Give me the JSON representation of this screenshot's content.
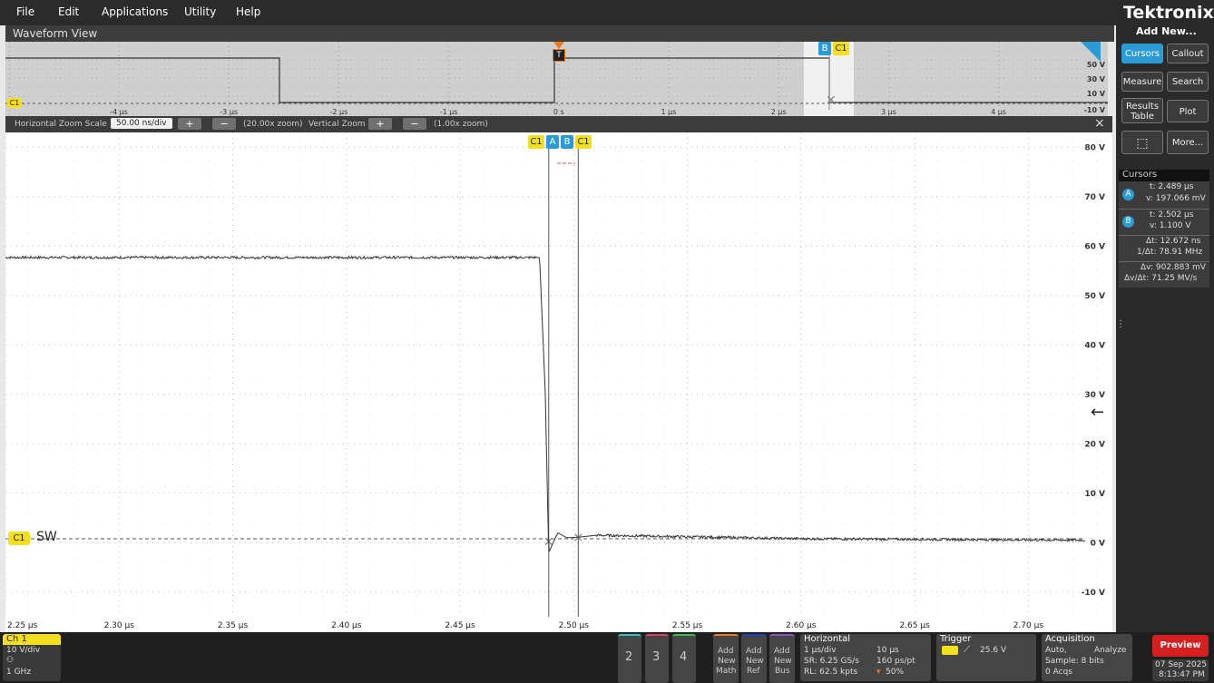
{
  "menu": {
    "items": [
      "File",
      "Edit",
      "Applications",
      "Utility",
      "Help"
    ]
  },
  "waveform_view": {
    "title": "Waveform View"
  },
  "overview": {
    "x_ticks": [
      "-4 µs",
      "-3 µs",
      "-2 µs",
      "-1 µs",
      "0 s",
      "1 µs",
      "2 µs",
      "3 µs",
      "4 µs"
    ],
    "y_ticks": [
      "50 V",
      "30 V",
      "10 V",
      "-10 V"
    ],
    "trigger_marker": "T",
    "cursor_b_label": "B",
    "channel_label": "C1"
  },
  "zoom_bar": {
    "h_label": "Horizontal Zoom Scale",
    "h_value": "50.00 ns/div",
    "h_zoom": "(20.00x zoom)",
    "v_label": "Vertical Zoom",
    "v_zoom": "(1.00x zoom)",
    "close": "×"
  },
  "main_plot": {
    "y_ticks": [
      "80 V",
      "70 V",
      "60 V",
      "50 V",
      "40 V",
      "30 V",
      "20 V",
      "10 V",
      "0 V",
      "-10 V"
    ],
    "x_ticks": [
      "2.25 µs",
      "2.30 µs",
      "2.35 µs",
      "2.40 µs",
      "2.45 µs",
      "2.50 µs",
      "2.55 µs",
      "2.60 µs",
      "2.65 µs",
      "2.70 µs"
    ],
    "channel_tag": "C1",
    "channel_name": "SW",
    "cursor_tags": [
      "C1",
      "A",
      "B",
      "C1"
    ]
  },
  "chart_data": {
    "type": "line",
    "series": [
      {
        "x": [
          2.25,
          2.485,
          2.4875,
          2.489,
          2.493,
          2.497,
          2.502,
          2.51,
          2.6,
          2.725
        ],
        "y": [
          57.7,
          57.7,
          30,
          -2,
          2,
          1,
          1.1,
          1.5,
          0.8,
          0.5
        ]
      }
    ],
    "xlim": [
      2.25,
      2.725
    ],
    "ylim": [
      -15,
      83
    ],
    "xlabel": "",
    "ylabel": ""
  },
  "right_panel": {
    "brand": "Tektronix",
    "add_new": "Add New...",
    "buttons": [
      "Cursors",
      "Callout",
      "Measure",
      "Search",
      "Results Table",
      "Plot",
      "More..."
    ],
    "cursors_title": "Cursors",
    "cursor_a_label": "A",
    "cursor_a_t": "t: 2.489 µs",
    "cursor_a_v": "v: 197.066 mV",
    "cursor_b_label": "B",
    "cursor_b_t": "t: 2.502 µs",
    "cursor_b_v": "v: 1.100 V",
    "delta_t": "Δt: 12.672 ns",
    "inv_delta_t": "1/Δt: 78.91 MHz",
    "delta_v": "Δv: 902.883 mV",
    "dv_dt": "Δv/Δt: 71.25 MV/s"
  },
  "bottom": {
    "ch1": {
      "title": "Ch 1",
      "scale": "10 V/div",
      "bw": "1 GHz"
    },
    "ch_buttons": [
      "2",
      "3",
      "4"
    ],
    "add_buttons": [
      [
        "Add",
        "New",
        "Math"
      ],
      [
        "Add",
        "New",
        "Ref"
      ],
      [
        "Add",
        "New",
        "Bus"
      ]
    ],
    "horizontal": {
      "title": "Horizontal",
      "scale": "1 µs/div",
      "window": "10 µs",
      "sr": "SR: 6.25 GS/s",
      "ps": "160 ps/pt",
      "rl": "RL: 62.5 kpts",
      "pos": "50%"
    },
    "trigger": {
      "title": "Trigger",
      "level": "25.6 V"
    },
    "acquisition": {
      "title": "Acquisition",
      "mode": "Auto,",
      "analyze": "Analyze",
      "sample": "Sample: 8 bits",
      "acqs": "0 Acqs"
    },
    "preview": "Preview",
    "date": "07 Sep 2025",
    "time": "8:13:47 PM"
  },
  "colors": {
    "ch1": "#f2e01f",
    "cursor": "#2b9bd6",
    "accent": "#2b9bd6",
    "preview": "#d42020"
  }
}
